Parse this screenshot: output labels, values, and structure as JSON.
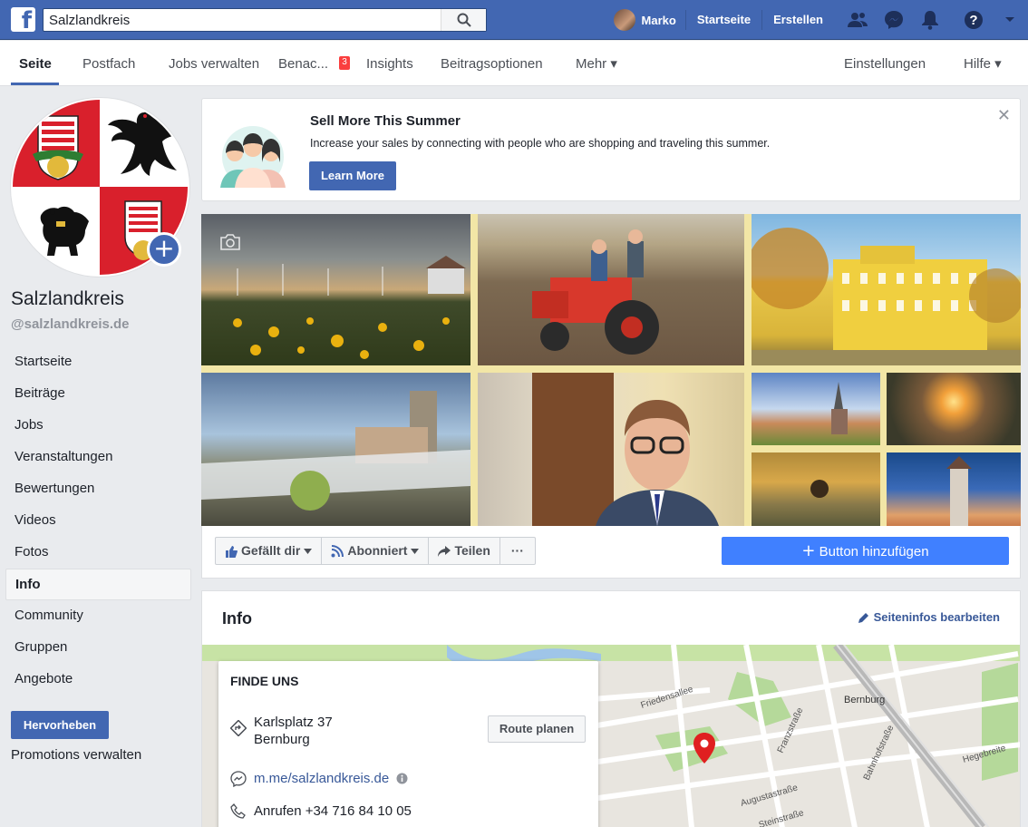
{
  "topbar": {
    "search_value": "Salzlandkreis",
    "user_name": "Marko",
    "home_label": "Startseite",
    "create_label": "Erstellen",
    "brand_color": "#4267b2"
  },
  "pagenav": {
    "tabs": [
      {
        "label": "Seite"
      },
      {
        "label": "Postfach"
      },
      {
        "label": "Jobs verwalten"
      },
      {
        "label": "Benac..."
      },
      {
        "label": "Insights"
      },
      {
        "label": "Beitragsoptionen"
      },
      {
        "label": "Mehr ▾"
      }
    ],
    "notifications_badge": "3",
    "settings_label": "Einstellungen",
    "help_label": "Hilfe ▾"
  },
  "sidebar": {
    "page_name": "Salzlandkreis",
    "handle": "@salzlandkreis.de",
    "items": [
      {
        "label": "Startseite"
      },
      {
        "label": "Beiträge"
      },
      {
        "label": "Jobs"
      },
      {
        "label": "Veranstaltungen"
      },
      {
        "label": "Bewertungen"
      },
      {
        "label": "Videos"
      },
      {
        "label": "Fotos"
      },
      {
        "label": "Info"
      },
      {
        "label": "Community"
      },
      {
        "label": "Gruppen"
      },
      {
        "label": "Angebote"
      }
    ],
    "promote_label": "Hervorheben",
    "promotions_label": "Promotions verwalten"
  },
  "ad": {
    "title": "Sell More This Summer",
    "description": "Increase your sales by connecting with people who are shopping and traveling this summer.",
    "cta": "Learn More"
  },
  "actions": {
    "like": "Gefällt dir",
    "follow": "Abonniert",
    "share": "Teilen",
    "more": "···",
    "add_button": "Button hinzufügen"
  },
  "info": {
    "title": "Info",
    "edit_label": "Seiteninfos bearbeiten",
    "find_us": "FINDE UNS",
    "address_line1": "Karlsplatz 37",
    "address_line2": "Bernburg",
    "route_label": "Route planen",
    "messenger_link": "m.me/salzlandkreis.de",
    "phone": "Anrufen +34 716 84 10 05"
  },
  "map_labels": {
    "city": "Bernburg",
    "streets": [
      "Friedensallee",
      "Franzstraße",
      "Augustastraße",
      "Steinstraße",
      "Bahnhofstraße",
      "Hegebreite"
    ]
  }
}
